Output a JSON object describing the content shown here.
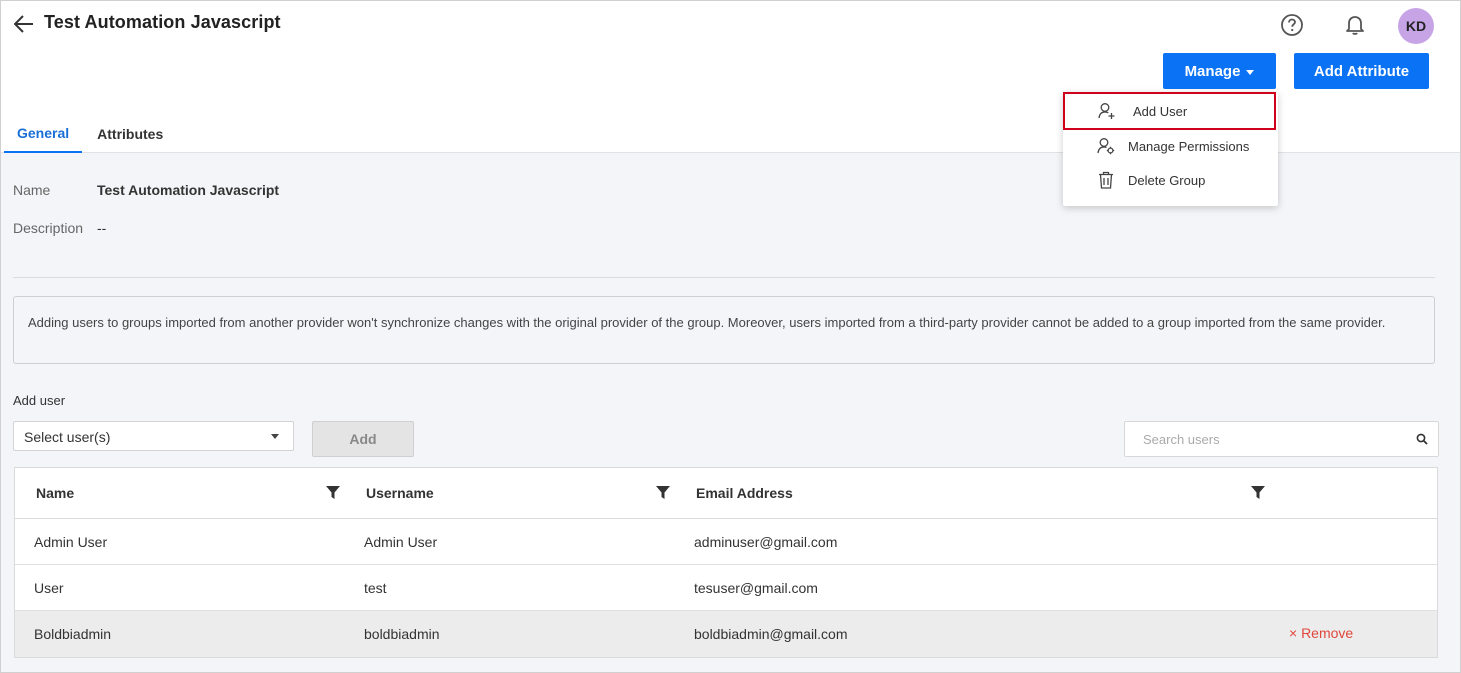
{
  "header": {
    "title": "Test Automation Javascript",
    "avatar_initials": "KD",
    "manage_label": "Manage",
    "add_attribute_label": "Add Attribute"
  },
  "tabs": [
    {
      "label": "General",
      "active": true
    },
    {
      "label": "Attributes",
      "active": false
    }
  ],
  "manage_menu": {
    "items": [
      {
        "label": "Add User",
        "icon": "add-user-icon"
      },
      {
        "label": "Manage Permissions",
        "icon": "user-settings-icon"
      },
      {
        "label": "Delete Group",
        "icon": "trash-icon"
      }
    ]
  },
  "details": {
    "name_label": "Name",
    "name_value": "Test Automation Javascript",
    "description_label": "Description",
    "description_value": "--"
  },
  "notice": "Adding users to groups imported from another provider won't synchronize changes with the original provider of the group. Moreover, users imported from a third-party provider cannot be added to a group imported from the same provider.",
  "add_user": {
    "label": "Add user",
    "select_placeholder": "Select user(s)",
    "add_button": "Add",
    "search_placeholder": "Search users"
  },
  "table": {
    "columns": [
      "Name",
      "Username",
      "Email Address"
    ],
    "rows": [
      {
        "name": "Admin User",
        "username": "Admin User",
        "email": "adminuser@gmail.com"
      },
      {
        "name": "User",
        "username": "test",
        "email": "tesuser@gmail.com"
      },
      {
        "name": "Boldbiadmin",
        "username": "boldbiadmin",
        "email": "boldbiadmin@gmail.com",
        "action": "× Remove"
      }
    ]
  },
  "colors": {
    "primary": "#0a73f5",
    "remove": "#e0473c",
    "avatar": "#c7a4e6",
    "highlight_border": "#d0021b"
  }
}
